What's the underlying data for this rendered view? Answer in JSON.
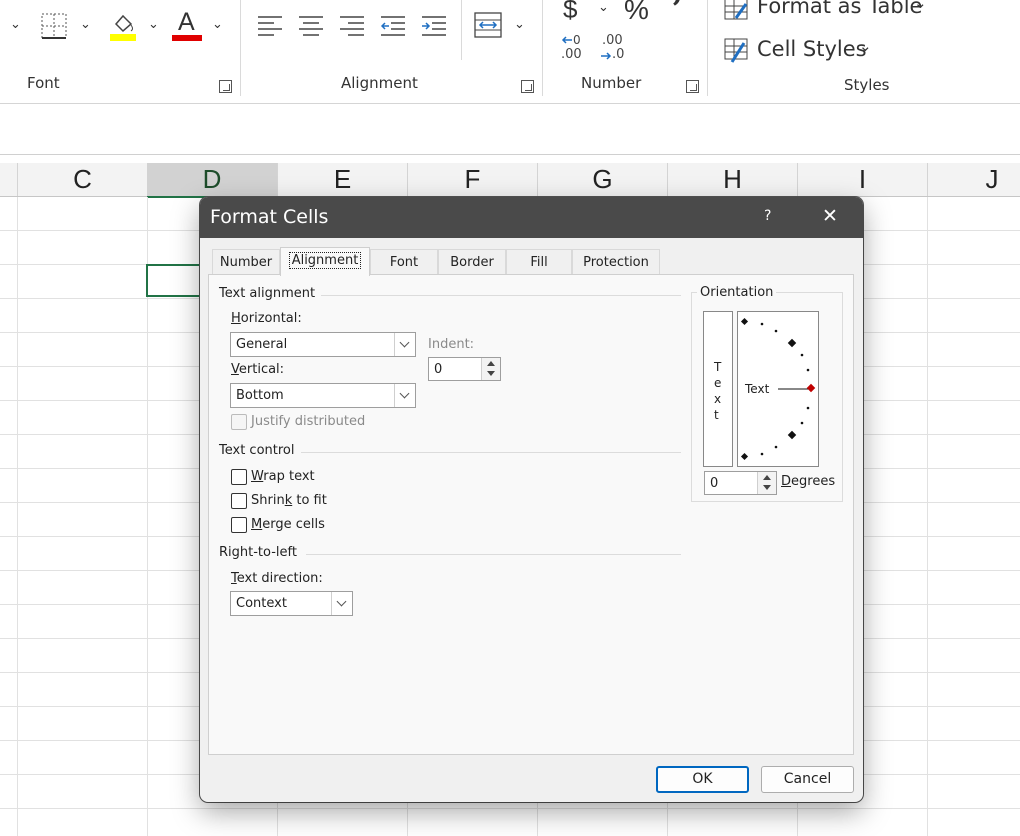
{
  "ribbon": {
    "groups": {
      "font": "Font",
      "alignment": "Alignment",
      "number": "Number",
      "styles": "Styles"
    },
    "number": {
      "currency_symbol": "$",
      "percent_symbol": "%",
      "comma_symbol": "ʼ",
      "increase_decimal": ".00",
      "decrease_decimal": ".0"
    },
    "styles": {
      "format_as_table": "Format as Table",
      "cell_styles": "Cell Styles"
    },
    "font_color_letter": "A",
    "colors": {
      "highlight": "#ffff00",
      "font_color": "#e00000",
      "accent_green": "#217346",
      "primary_blue": "#0067c0"
    }
  },
  "sheet": {
    "columns": [
      "C",
      "D",
      "E",
      "F",
      "G",
      "H",
      "I",
      "J"
    ],
    "selected_column": "D"
  },
  "dialog": {
    "title": "Format Cells",
    "help": "?",
    "close": "✕",
    "tabs": [
      "Number",
      "Alignment",
      "Font",
      "Border",
      "Fill",
      "Protection"
    ],
    "active_tab": "Alignment",
    "text_alignment": {
      "section": "Text alignment",
      "horizontal_label_u": "H",
      "horizontal_label_rest": "orizontal:",
      "horizontal_value": "General",
      "indent_label": "Indent:",
      "indent_value": "0",
      "vertical_label_u": "V",
      "vertical_label_rest": "ertical:",
      "vertical_value": "Bottom",
      "justify_distributed": "Justify distributed"
    },
    "text_control": {
      "section": "Text control",
      "wrap_u": "W",
      "wrap_rest": "rap text",
      "shrink_pre": "Shrin",
      "shrink_u": "k",
      "shrink_rest": " to fit",
      "merge_u": "M",
      "merge_rest": "erge cells"
    },
    "rtl": {
      "section": "Right-to-left",
      "direction_label_u": "T",
      "direction_label_rest": "ext direction:",
      "direction_value": "Context"
    },
    "orientation": {
      "section": "Orientation",
      "vertical_letters": [
        "T",
        "e",
        "x",
        "t"
      ],
      "dial_text": "Text",
      "degrees_value": "0",
      "degrees_label_u": "D",
      "degrees_label_rest": "egrees",
      "pointer_color": "#c00000"
    },
    "buttons": {
      "ok": "OK",
      "cancel": "Cancel"
    }
  }
}
